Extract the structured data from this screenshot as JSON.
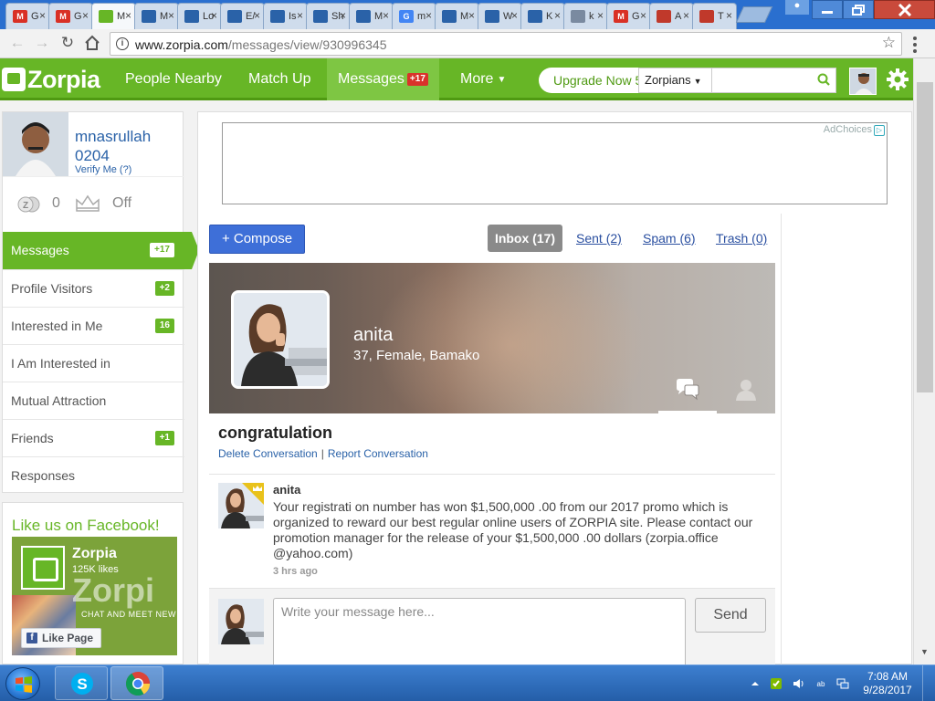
{
  "browser": {
    "tabs": [
      {
        "favicon": "gmail-icon",
        "label": "G",
        "fav_text": "M",
        "fav_color": "#d93025"
      },
      {
        "favicon": "gmail-icon",
        "label": "G",
        "fav_text": "M",
        "fav_color": "#d93025"
      },
      {
        "favicon": "zorpia-icon",
        "label": "M",
        "fav_text": "",
        "fav_color": "#67b626"
      },
      {
        "favicon": "graduation-cap-icon",
        "label": "M",
        "fav_text": "",
        "fav_color": "#2a62a8"
      },
      {
        "favicon": "graduation-cap-icon",
        "label": "Lo",
        "fav_text": "",
        "fav_color": "#2a62a8"
      },
      {
        "favicon": "graduation-cap-icon",
        "label": "E/",
        "fav_text": "",
        "fav_color": "#2a62a8"
      },
      {
        "favicon": "graduation-cap-icon",
        "label": "Is",
        "fav_text": "",
        "fav_color": "#2a62a8"
      },
      {
        "favicon": "graduation-cap-icon",
        "label": "Sh",
        "fav_text": "",
        "fav_color": "#2a62a8"
      },
      {
        "favicon": "graduation-cap-icon",
        "label": "M",
        "fav_text": "",
        "fav_color": "#2a62a8"
      },
      {
        "favicon": "google-icon",
        "label": "m",
        "fav_text": "G",
        "fav_color": "#4285f4"
      },
      {
        "favicon": "graduation-cap-icon",
        "label": "M",
        "fav_text": "",
        "fav_color": "#2a62a8"
      },
      {
        "favicon": "graduation-cap-icon",
        "label": "W",
        "fav_text": "",
        "fav_color": "#2a62a8"
      },
      {
        "favicon": "graduation-cap-icon",
        "label": "K",
        "fav_text": "",
        "fav_color": "#2a62a8"
      },
      {
        "favicon": "document-icon",
        "label": "k",
        "fav_text": "",
        "fav_color": "#7a8aa0"
      },
      {
        "favicon": "gmail-icon",
        "label": "G",
        "fav_text": "M",
        "fav_color": "#d93025"
      },
      {
        "favicon": "chart-icon",
        "label": "A",
        "fav_text": "",
        "fav_color": "#c0392b"
      },
      {
        "favicon": "chart-icon",
        "label": "T",
        "fav_text": "",
        "fav_color": "#c0392b"
      }
    ],
    "url_host": "www.zorpia.com",
    "url_path": "/messages/view/930996345"
  },
  "header": {
    "logo": "Zorpia",
    "nav": {
      "people_nearby": "People Nearby",
      "match_up": "Match Up",
      "messages": "Messages",
      "messages_badge": "+17",
      "more": "More"
    },
    "upgrade": "Upgrade Now 5",
    "search_scope": "Zorpians",
    "search_placeholder": ""
  },
  "profile": {
    "username": "mnasrullah 0204",
    "verify": "Verify Me (?)",
    "coins": "0",
    "vip": "Off"
  },
  "sidebar_menu": [
    {
      "label": "Messages",
      "count": "+17",
      "active": true
    },
    {
      "label": "Profile Visitors",
      "count": "+2"
    },
    {
      "label": "Interested in Me",
      "count": "16"
    },
    {
      "label": "I Am Interested in",
      "count": ""
    },
    {
      "label": "Mutual Attraction",
      "count": ""
    },
    {
      "label": "Friends",
      "count": "+1"
    },
    {
      "label": "Responses",
      "count": ""
    }
  ],
  "facebook": {
    "title": "Like us on Facebook!",
    "page_name": "Zorpia",
    "likes": "125K likes",
    "brand_text": "Zorpi",
    "tagline": "CHAT AND MEET NEW PEO",
    "like_button": "Like Page"
  },
  "ad": {
    "adchoices": "AdChoices"
  },
  "messages": {
    "compose": "+ Compose",
    "folders": {
      "inbox": "Inbox (17)",
      "sent": "Sent (2)",
      "spam": "Spam (6)",
      "trash": "Trash (0)"
    }
  },
  "conversation": {
    "partner_name": "anita",
    "partner_info": "37, Female, Bamako",
    "subject": "congratulation",
    "delete": "Delete Conversation",
    "report": "Report Conversation",
    "separator": "|",
    "message": {
      "sender": "anita",
      "body": "Your registrati on number has won $1,500,000 .00 from our 2017 promo which is organized to reward our best regular online users of ZORPIA site. Please contact our promotion manager for the release of your $1,500,000 .00 dollars (zorpia.office @yahoo.com)",
      "time": "3 hrs ago"
    },
    "reply_placeholder": "Write your message here...",
    "send": "Send"
  },
  "taskbar": {
    "time": "7:08 AM",
    "date": "9/28/2017"
  },
  "colors": {
    "brand_green": "#67b626",
    "link_blue": "#2a62a8",
    "badge_red": "#d9332b",
    "compose_blue": "#3e6fd8"
  }
}
